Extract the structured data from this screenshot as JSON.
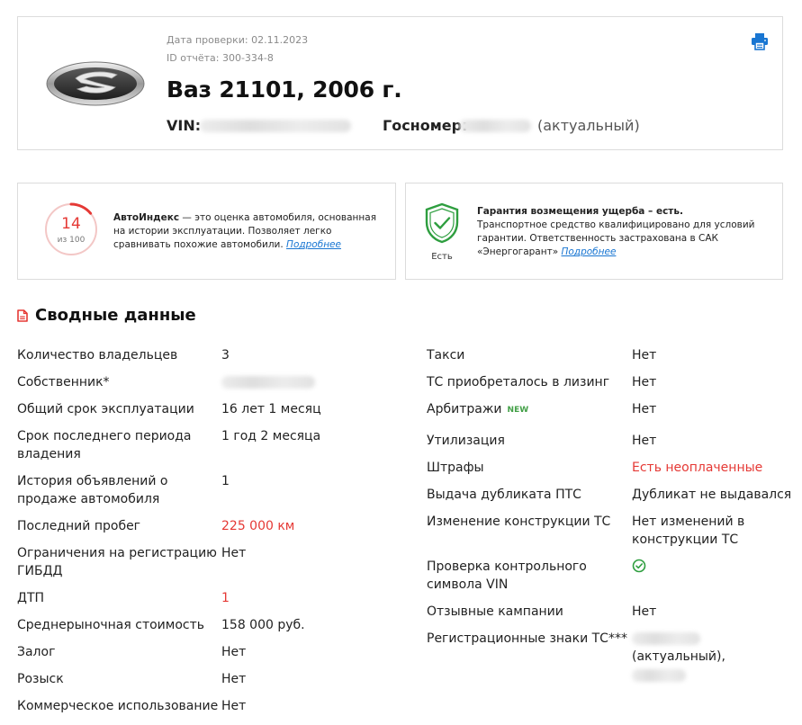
{
  "header": {
    "check_date": "Дата проверки: 02.11.2023",
    "report_id": "ID отчёта: 300-334-8",
    "title": "Ваз 21101, 2006 г.",
    "vin_label": "VIN:",
    "gosnomer_label": "Госномер:",
    "gosnomer_status": "(актуальный)",
    "print_icon": "printer-icon",
    "logo": "lada-logo"
  },
  "autoindex": {
    "score": "14",
    "score_sub": "из 100",
    "score_value": 14,
    "score_max": 100,
    "title": "АвтоИндекс",
    "text": " — это оценка автомобиля, основанная на истории эксплуатации. Позволяет легко сравнивать похожие автомобили. ",
    "link": "Подробнее",
    "accent": "#e53935"
  },
  "guarantee": {
    "title": "Гарантия возмещения ущерба – есть.",
    "text": " Транспортное средство квалифицировано для условий гарантии. Ответственность застрахована в САК «Энергогарант» ",
    "link": "Подробнее",
    "status": "Есть",
    "icon": "shield-check-icon",
    "accent": "#2e9e3f"
  },
  "summary": {
    "title": "Сводные данные",
    "left": [
      {
        "label": "Количество владельцев",
        "value": "3"
      },
      {
        "label": "Собственник*",
        "value": ""
      },
      {
        "label": "Общий срок эксплуатации",
        "value": "16 лет 1 месяц"
      },
      {
        "label": "Срок последнего периода владения",
        "value": "1 год 2 месяца"
      },
      {
        "label": "История объявлений о продаже автомобиля",
        "value": "1"
      },
      {
        "label": "Последний пробег",
        "value": "225 000 км"
      },
      {
        "label": "Ограничения на регистрацию ГИБДД",
        "value": "Нет"
      },
      {
        "label": "ДТП",
        "value": "1"
      },
      {
        "label": "Среднерыночная стоимость",
        "value": "158 000 руб."
      },
      {
        "label": "Залог",
        "value": "Нет"
      },
      {
        "label": "Розыск",
        "value": "Нет"
      },
      {
        "label": "Коммерческое использование",
        "value": "Нет"
      }
    ],
    "right": [
      {
        "label": "Такси",
        "value": "Нет"
      },
      {
        "label": "ТС приобреталось в лизинг",
        "value": "Нет"
      },
      {
        "label": "Арбитражи",
        "badge": "NEW",
        "value": "Нет"
      },
      {
        "label": "Утилизация",
        "value": "Нет"
      },
      {
        "label": "Штрафы",
        "value": "Есть неоплаченные"
      },
      {
        "label": "Выдача дубликата ПТС",
        "value": "Дубликат не выдавался"
      },
      {
        "label": "Изменение конструкции ТС",
        "value": "Нет изменений в конструкции ТС"
      },
      {
        "label": "Проверка контрольного символа VIN",
        "value": ""
      },
      {
        "label": "Отзывные кампании",
        "value": "Нет"
      },
      {
        "label": "Регистрационные знаки ТС***",
        "value": "(актуальный),"
      }
    ]
  },
  "colors": {
    "danger": "#e53935",
    "link": "#1976d2",
    "ok": "#2e9e3f"
  }
}
